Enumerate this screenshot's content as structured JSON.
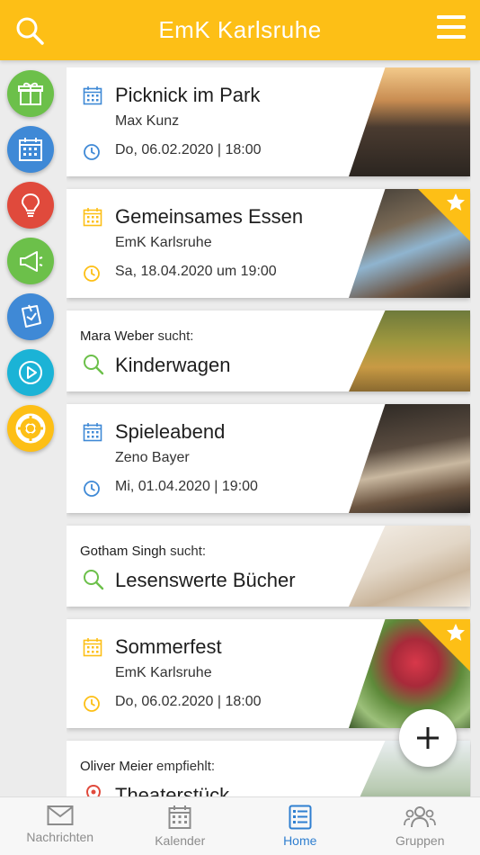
{
  "header": {
    "title": "EmK Karlsruhe"
  },
  "colors": {
    "accent": "#fdbf16",
    "blue": "#2f7fd0",
    "green": "#6cc04a",
    "red": "#e04a3c"
  },
  "rail": [
    {
      "icon": "gift-icon",
      "color": "#6cc04a"
    },
    {
      "icon": "calendar-icon",
      "color": "#3f89d6"
    },
    {
      "icon": "lightbulb-icon",
      "color": "#e04a3c"
    },
    {
      "icon": "megaphone-icon",
      "color": "#6cc04a"
    },
    {
      "icon": "note-icon",
      "color": "#3f89d6"
    },
    {
      "icon": "play-icon",
      "color": "#1bb3d6"
    },
    {
      "icon": "lifebuoy-icon",
      "color": "#fdbf16"
    }
  ],
  "feed": {
    "c1": {
      "title": "Picknick im Park",
      "sub": "Max Kunz",
      "date": "Do, 06.02.2020 | 18:00"
    },
    "c2": {
      "title": "Gemeinsames Essen",
      "sub": "EmK Karlsruhe",
      "date": "Sa, 18.04.2020 um 19:00"
    },
    "c3": {
      "name": "Mara Weber",
      "verb": "sucht:",
      "item": "Kinderwagen"
    },
    "c4": {
      "title": "Spieleabend",
      "sub": "Zeno Bayer",
      "date": "Mi, 01.04.2020 | 19:00"
    },
    "c5": {
      "name": "Gotham Singh",
      "verb": "sucht:",
      "item": "Lesenswerte Bücher"
    },
    "c6": {
      "title": "Sommerfest",
      "sub": "EmK Karlsruhe",
      "date": "Do, 06.02.2020 | 18:00"
    },
    "c7": {
      "name": "Oliver Meier",
      "verb": "empfiehlt:",
      "item": "Theaterstück"
    }
  },
  "tabs": [
    {
      "label": "Nachrichten",
      "icon": "mail-icon"
    },
    {
      "label": "Kalender",
      "icon": "calendar-icon"
    },
    {
      "label": "Home",
      "icon": "home-list-icon"
    },
    {
      "label": "Gruppen",
      "icon": "group-icon"
    }
  ]
}
